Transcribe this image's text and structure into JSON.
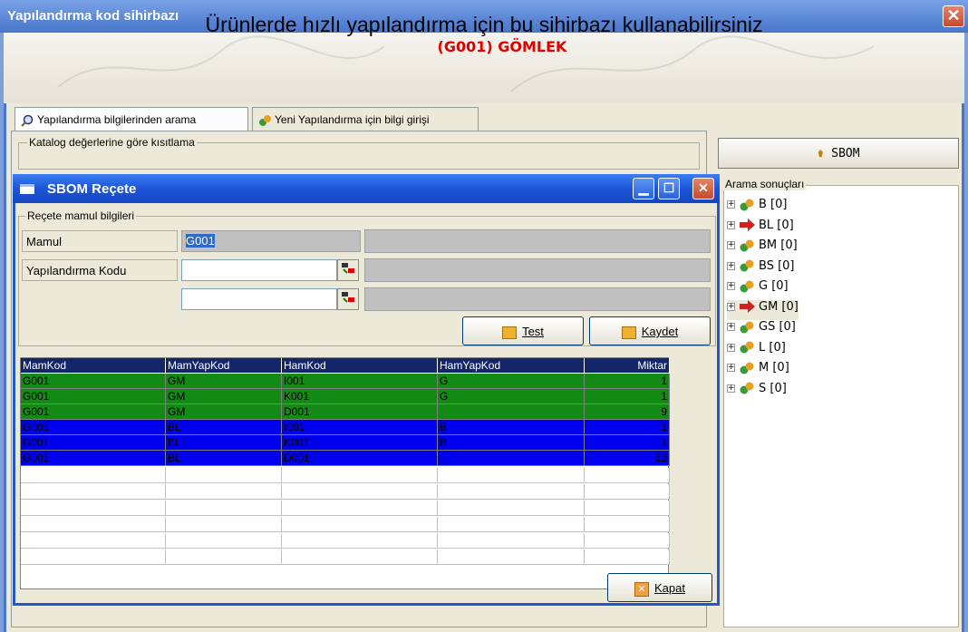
{
  "window": {
    "title": "Yapılandırma kod sihirbazı",
    "close": "✕"
  },
  "banner": {
    "title": "Ürünlerde hızlı yapılandırma için bu sihirbazı kullanabilirsiniz",
    "subtitle": "(G001) GÖMLEK"
  },
  "tabs": [
    {
      "label": "Yapılandırma bilgilerinden arama",
      "icon": "search-icon"
    },
    {
      "label": "Yeni Yapılandırma için bilgi girişi",
      "icon": "parts-icon"
    }
  ],
  "katalog": {
    "legend": "Katalog değerlerine göre kısıtlama"
  },
  "sbom_button": {
    "label": "SBOM",
    "icon": "flask-icon"
  },
  "results": {
    "legend": "Arama sonuçları",
    "items": [
      {
        "label": "B [0]",
        "icon": "parts-icon"
      },
      {
        "label": "BL [0]",
        "icon": "red-arrow-icon"
      },
      {
        "label": "BM [0]",
        "icon": "parts-icon"
      },
      {
        "label": "BS [0]",
        "icon": "parts-icon"
      },
      {
        "label": "G [0]",
        "icon": "parts-icon"
      },
      {
        "label": "GM [0]",
        "icon": "red-arrow-icon"
      },
      {
        "label": "GS [0]",
        "icon": "parts-icon"
      },
      {
        "label": "L [0]",
        "icon": "parts-icon"
      },
      {
        "label": "M [0]",
        "icon": "parts-icon"
      },
      {
        "label": "S [0]",
        "icon": "parts-icon"
      }
    ]
  },
  "dialog": {
    "title": "SBOM Reçete",
    "legend": "Reçete mamul bilgileri",
    "mamul_label": "Mamul",
    "mamul_value": "G001",
    "yap_label": "Yapılandırma Kodu",
    "yap_value1": "",
    "yap_value2": "",
    "test_label": "Test",
    "kaydet_label": "Kaydet",
    "kapat_label": "Kapat"
  },
  "grid": {
    "columns": [
      "MamKod",
      "MamYapKod",
      "HamKod",
      "HamYapKod",
      "Miktar"
    ],
    "rows": [
      {
        "cells": [
          "G001",
          "GM",
          "I001",
          "G",
          "1"
        ],
        "color": "green"
      },
      {
        "cells": [
          "G001",
          "GM",
          "K001",
          "G",
          "1"
        ],
        "color": "green"
      },
      {
        "cells": [
          "G001",
          "GM",
          "D001",
          "",
          "9"
        ],
        "color": "green"
      },
      {
        "cells": [
          "G001",
          "BL",
          "I001",
          "B",
          "1"
        ],
        "color": "blue"
      },
      {
        "cells": [
          "G001",
          "BL",
          "K001",
          "B",
          "1"
        ],
        "color": "blue"
      },
      {
        "cells": [
          "G001",
          "BL",
          "D001",
          "",
          "12"
        ],
        "color": "blue"
      }
    ]
  },
  "colors": {
    "green_row": "#138a13",
    "blue_row": "#0000ef",
    "header": "#14266a",
    "subtitle": "#e00000"
  }
}
